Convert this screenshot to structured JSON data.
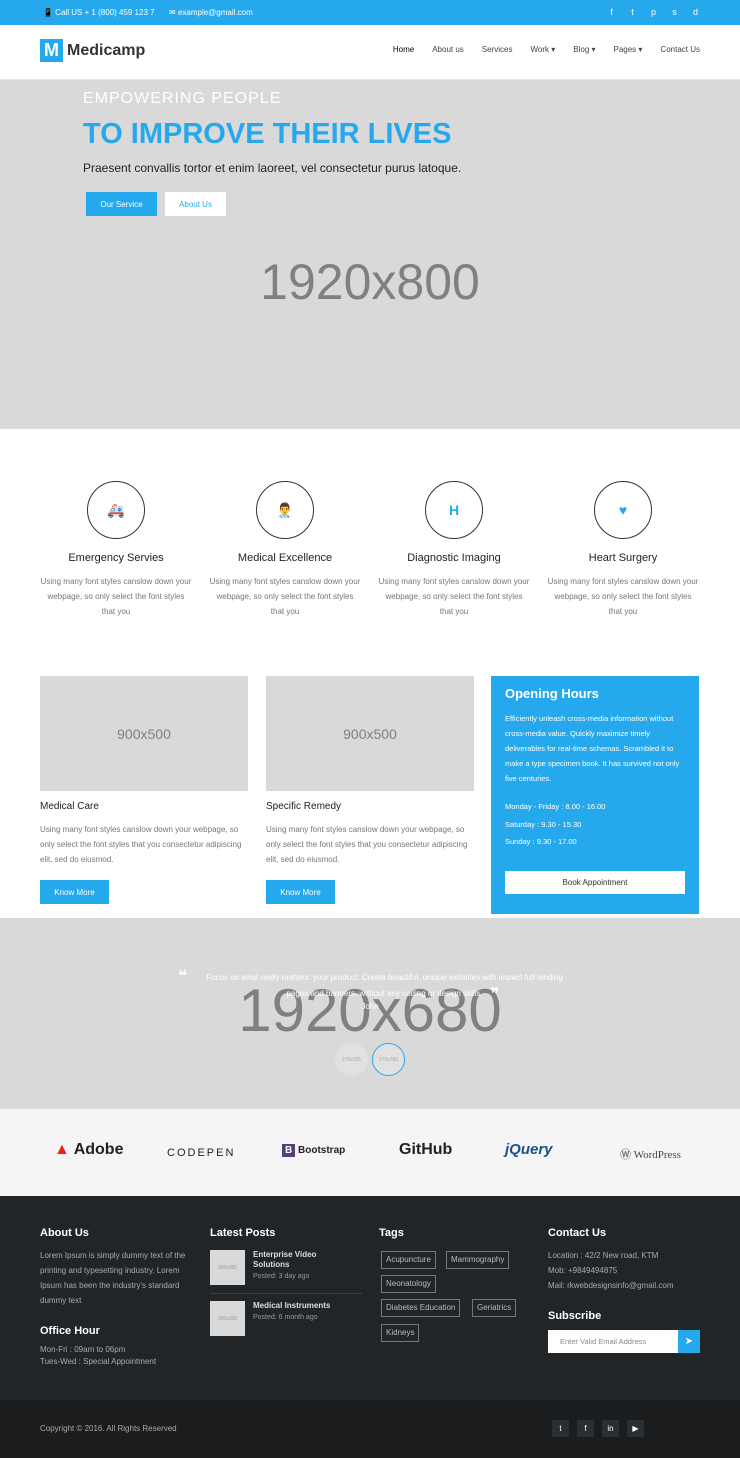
{
  "topbar": {
    "call": "📱 Call US + 1 (800) 459 123 7",
    "email": "✉ example@gmail.com",
    "social": [
      "f",
      "t",
      "p",
      "s",
      "d"
    ]
  },
  "nav": {
    "logo_letter": "M",
    "logo_text": "Medicamp",
    "items": [
      "Home",
      "About us",
      "Services",
      "Work ▾",
      "Blog ▾",
      "Pages ▾",
      "Contact Us"
    ]
  },
  "hero": {
    "kicker": "EMPOWERING PEOPLE",
    "headline": "TO IMPROVE THEIR LIVES",
    "sub": "Praesent convallis tortor et enim laoreet, vel consectetur purus latoque.",
    "btn_service": "Our Service",
    "btn_about": "About Us",
    "placeholder": "1920x800"
  },
  "features": [
    {
      "icon": "ambulance-icon",
      "glyph": "🚑",
      "title": "Emergency Servies",
      "desc": "Using many font styles canslow down your webpage, so only select the font styles that you"
    },
    {
      "icon": "doctor-icon",
      "glyph": "👨‍⚕",
      "title": "Medical Excellence",
      "desc": "Using many font styles canslow down your webpage, so only select the font styles that you"
    },
    {
      "icon": "hospital-icon",
      "glyph": "H",
      "title": "Diagnostic Imaging",
      "desc": "Using many font styles canslow down your webpage, so only select the font styles that you"
    },
    {
      "icon": "heartbeat-icon",
      "glyph": "♥",
      "title": "Heart Surgery",
      "desc": "Using many font styles canslow down your webpage, so only select the font styles that you"
    }
  ],
  "cards": [
    {
      "img": "900x500",
      "title": "Medical Care",
      "desc": "Using many font styles canslow down your webpage, so only select the font styles that you consectetur adipiscing elit, sed do eiusmod.",
      "btn": "Know More"
    },
    {
      "img": "900x500",
      "title": "Specific Remedy",
      "desc": "Using many font styles canslow down your webpage, so only select the font styles that you consectetur adipiscing elit, sed do eiusmod.",
      "btn": "Know More"
    }
  ],
  "hours": {
    "title": "Opening Hours",
    "desc": "Efficiently unleash cross-media information without cross-media value. Quickly maximize timely deliverables for real-time schemas. Scrambled it to make a type specimen book. It has survived not only five centuries.",
    "schedule": [
      "Monday - Friday : 8.00 - 16.00",
      "Saturday : 9.30 - 15.30",
      "Sunday : 9.30 - 17.00"
    ],
    "btn": "Book Appointment"
  },
  "testimonial": {
    "placeholder": "1920x680",
    "quote": "Focus on what really matters: your product. Create beautiful, unique websites with impact full landing pages and banners, without any coding or design skills.",
    "name": "John",
    "avatars": [
      "270x285",
      "270x285"
    ]
  },
  "brands": [
    "Adobe",
    "CODEPEN",
    "Bootstrap",
    "GitHub",
    "jQuery",
    "WordPress"
  ],
  "footer": {
    "about_title": "About Us",
    "about_text": "Lorem Ipsum is simply dummy text of the printing and typesetting industry. Lorem Ipsum has been the industry's standard dummy text",
    "office_title": "Office Hour",
    "office_lines": [
      "Mon-Fri : 09am to 06pm",
      "Tues-Wed : Special Appointment"
    ],
    "posts_title": "Latest Posts",
    "posts": [
      {
        "thumb": "200x200",
        "title": "Enterprise Video Solutions",
        "date": "Posted: 3 day ago"
      },
      {
        "thumb": "200x200",
        "title": "Medical Instruments",
        "date": "Posted: 6 month ago"
      }
    ],
    "tags_title": "Tags",
    "tags": [
      "Acupuncture",
      "Mammography",
      "Neonatology",
      "Diabetes Education",
      "Geriatrics",
      "Kidneys"
    ],
    "contact_title": "Contact Us",
    "contact_lines": [
      "Location : 42/2 New road, KTM",
      "Mob: +9849494875",
      "Mail: rkwebdesignsinfo@gmail.com"
    ],
    "subscribe_title": "Subscribe",
    "subscribe_placeholder": "Enter Valid Email Address"
  },
  "bottom": {
    "copyright": "Copyright © 2016. All Rights Reserved",
    "social": [
      "t",
      "f",
      "in",
      "▶"
    ]
  },
  "colors": {
    "accent": "#26a9ec",
    "footer_bg": "#222527"
  }
}
